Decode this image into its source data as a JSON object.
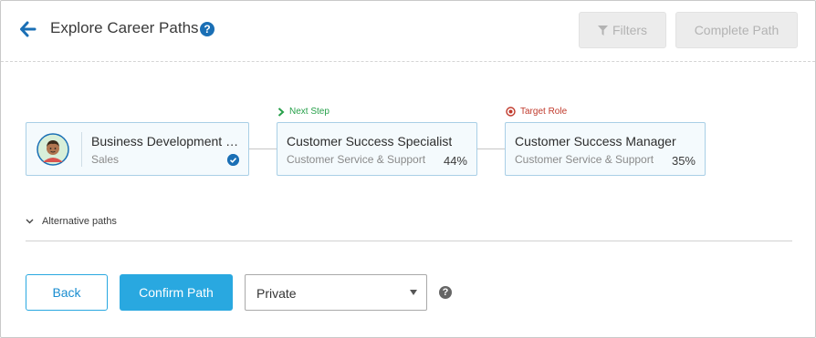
{
  "header": {
    "title": "Explore Career Paths",
    "help_glyph": "?",
    "filters_label": "Filters",
    "complete_label": "Complete Path"
  },
  "path": {
    "current": {
      "title": "Business Development R...",
      "subtitle": "Sales",
      "status_icon": "check-circle-icon"
    },
    "next": {
      "tag": "Next Step",
      "title": "Customer Success Specialist",
      "subtitle": "Customer Service & Support",
      "match": "44%"
    },
    "target": {
      "tag": "Target Role",
      "title": "Customer Success Manager",
      "subtitle": "Customer Service & Support",
      "match": "35%"
    }
  },
  "alternatives": {
    "label": "Alternative paths"
  },
  "footer": {
    "back_label": "Back",
    "confirm_label": "Confirm Path",
    "visibility_value": "Private",
    "help_glyph": "?"
  },
  "colors": {
    "accent": "#29a8e0",
    "primary_icon": "#1a6fb5",
    "next_step": "#27a04a",
    "target_role": "#c0392b",
    "card_border": "#a9cfe6"
  }
}
